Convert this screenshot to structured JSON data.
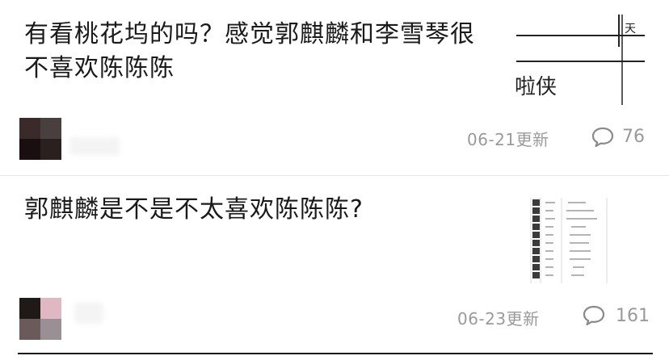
{
  "posts": [
    {
      "title": "有看桃花坞的吗？感觉郭麒麟和李雪琴很不喜欢陈陈陈",
      "date": "06-21更新",
      "comment_count": "76",
      "thumbnail_text": "啦侠",
      "avatar_colors": [
        "#3a2a2a",
        "#4a3f3f",
        "#1a0f10",
        "#2b2020"
      ]
    },
    {
      "title": "郭麒麟是不是不太喜欢陈陈陈?",
      "date": "06-23更新",
      "comment_count": "161",
      "avatar_colors": [
        "#1f1a18",
        "#e0b8c3",
        "#6b5a5a",
        "#9a8f94"
      ]
    }
  ],
  "icons": {
    "comment": "comment-bubble-icon"
  },
  "colors": {
    "meta_text": "#9a9a9a",
    "divider": "#e6e6e6"
  }
}
